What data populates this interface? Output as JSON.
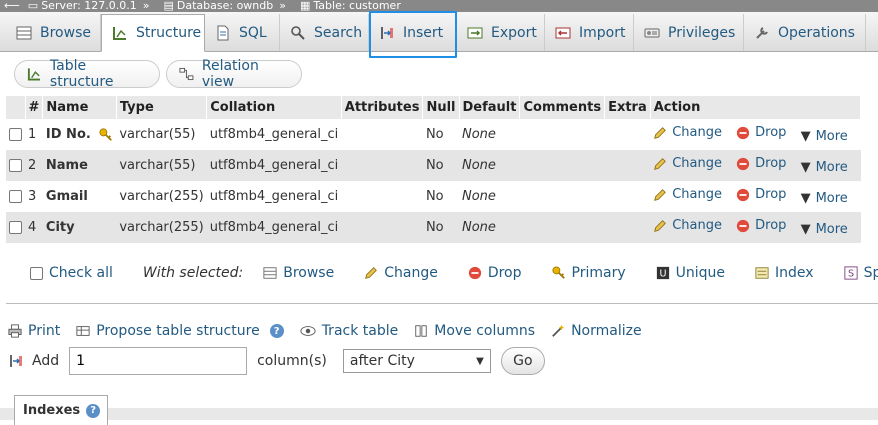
{
  "breadcrumb": [
    {
      "label": "Server: 127.0.0.1",
      "icon": "server-icon"
    },
    {
      "label": "Database: owndb",
      "icon": "database-icon"
    },
    {
      "label": "Table: customer",
      "icon": "table-icon"
    }
  ],
  "tabs": [
    {
      "label": "Browse"
    },
    {
      "label": "Structure"
    },
    {
      "label": "SQL"
    },
    {
      "label": "Search"
    },
    {
      "label": "Insert"
    },
    {
      "label": "Export"
    },
    {
      "label": "Import"
    },
    {
      "label": "Privileges"
    },
    {
      "label": "Operations"
    }
  ],
  "subtabs": {
    "table_structure": "Table structure",
    "relation_view": "Relation view"
  },
  "columns": [
    "#",
    "Name",
    "Type",
    "Collation",
    "Attributes",
    "Null",
    "Default",
    "Comments",
    "Extra",
    "Action"
  ],
  "rows": [
    {
      "num": "1",
      "name": "ID No.",
      "type": "varchar(55)",
      "collation": "utf8mb4_general_ci",
      "null": "No",
      "default": "None"
    },
    {
      "num": "2",
      "name": "Name",
      "type": "varchar(55)",
      "collation": "utf8mb4_general_ci",
      "null": "No",
      "default": "None"
    },
    {
      "num": "3",
      "name": "Gmail",
      "type": "varchar(255)",
      "collation": "utf8mb4_general_ci",
      "null": "No",
      "default": "None"
    },
    {
      "num": "4",
      "name": "City",
      "type": "varchar(255)",
      "collation": "utf8mb4_general_ci",
      "null": "No",
      "default": "None"
    }
  ],
  "row_actions": {
    "change": "Change",
    "drop": "Drop",
    "more": "More"
  },
  "with_selected": {
    "check_all": "Check all",
    "label": "With selected:",
    "browse": "Browse",
    "change": "Change",
    "drop": "Drop",
    "primary": "Primary",
    "unique": "Unique",
    "index": "Index",
    "spatial": "Spatial"
  },
  "ops": {
    "print": "Print",
    "propose": "Propose table structure",
    "track": "Track table",
    "move": "Move columns",
    "normalize": "Normalize"
  },
  "add": {
    "label": "Add",
    "value": "1",
    "columns_label": "column(s)",
    "position": "after City",
    "go": "Go"
  },
  "indexes": {
    "label": "Indexes"
  },
  "colors": {
    "link": "#235a81",
    "highlight": "#1f8fe6",
    "row_alt": "#e5e5e5"
  }
}
